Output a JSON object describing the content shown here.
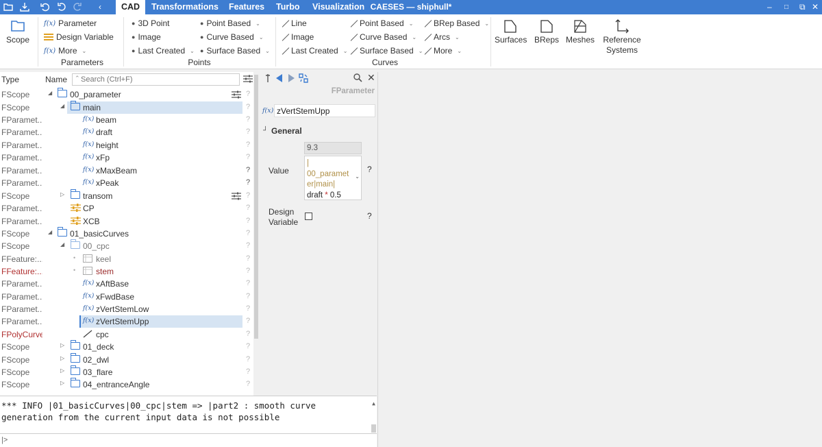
{
  "window": {
    "title": "CAESES — shiphull*",
    "controls": [
      "–",
      "□",
      "✕"
    ]
  },
  "menu_tabs": [
    "CAD",
    "Transformations",
    "Features",
    "Turbo",
    "Visualization"
  ],
  "ribbon": {
    "scope_label": "Scope",
    "parameters": {
      "items": [
        "Parameter",
        "Design Variable",
        "More"
      ],
      "group_label": "Parameters"
    },
    "points": {
      "items": [
        "3D Point",
        "Image",
        "Last Created",
        "Point Based",
        "Curve Based",
        "Surface Based"
      ],
      "group_label": "Points"
    },
    "curves": {
      "items": [
        "Line",
        "Image",
        "Last Created",
        "Point Based",
        "Curve Based",
        "Surface Based",
        "BRep Based",
        "Arcs",
        "More"
      ],
      "group_label": "Curves"
    },
    "big_buttons": [
      "Surfaces",
      "BReps",
      "Meshes",
      "Reference",
      "Systems"
    ]
  },
  "tree": {
    "col_type": "Type",
    "col_name": "Name",
    "search_placeholder": "Search (Ctrl+F)",
    "rows": [
      {
        "type": "FScope",
        "name": "00_parameter",
        "q": "?"
      },
      {
        "type": "FScope",
        "name": "main",
        "q": "?"
      },
      {
        "type": "FParamet...",
        "name": "beam",
        "q": "?"
      },
      {
        "type": "FParamet...",
        "name": "draft",
        "q": "?"
      },
      {
        "type": "FParamet...",
        "name": "height",
        "q": "?"
      },
      {
        "type": "FParamet...",
        "name": "xFp",
        "q": "?"
      },
      {
        "type": "FParamet...",
        "name": "xMaxBeam",
        "q": "?"
      },
      {
        "type": "FParamet...",
        "name": "xPeak",
        "q": "?"
      },
      {
        "type": "FScope",
        "name": "transom",
        "q": "?"
      },
      {
        "type": "FParamet...",
        "name": "CP",
        "q": "?"
      },
      {
        "type": "FParamet...",
        "name": "XCB",
        "q": "?"
      },
      {
        "type": "FScope",
        "name": "01_basicCurves",
        "q": "?"
      },
      {
        "type": "FScope",
        "name": "00_cpc",
        "q": "?"
      },
      {
        "type": "FFeature:...",
        "name": "keel",
        "q": "?"
      },
      {
        "type": "FFeature:...",
        "name": "stem",
        "q": "?"
      },
      {
        "type": "FParamet...",
        "name": "xAftBase",
        "q": "?"
      },
      {
        "type": "FParamet...",
        "name": "xFwdBase",
        "q": "?"
      },
      {
        "type": "FParamet...",
        "name": "zVertStemLow",
        "q": "?"
      },
      {
        "type": "FParamet...",
        "name": "zVertStemUpp",
        "q": "?"
      },
      {
        "type": "FPolyCurve",
        "name": "cpc",
        "q": "?"
      },
      {
        "type": "FScope",
        "name": "01_deck",
        "q": "?"
      },
      {
        "type": "FScope",
        "name": "02_dwl",
        "q": "?"
      },
      {
        "type": "FScope",
        "name": "03_flare",
        "q": "?"
      },
      {
        "type": "FScope",
        "name": "04_entranceAngle",
        "q": "?"
      }
    ]
  },
  "properties": {
    "class_name": "FParameter",
    "fx_label": "f(x)",
    "name_value": "zVertStemUpp",
    "section": "General",
    "value_label": "Value",
    "value_result": "9.3",
    "expr_prefix": "|",
    "expr_path1": "00_paramet",
    "expr_path2": "er|main|",
    "expr_var": "draft",
    "expr_op": "*",
    "expr_num": "0.5",
    "help": "?",
    "dv_label1": "Design",
    "dv_label2": "Variable"
  },
  "console": {
    "line1": "*** INFO |01_basicCurves|00_cpc|stem => |part2 : smooth curve",
    "line2": "generation from the current input data is not possible",
    "prompt": "|>"
  },
  "colors": {
    "titlebar": "#3e7dd1",
    "selection": "#d6e4f3",
    "icon_blue": "#3e7dd1",
    "error_red": "#b03030"
  }
}
